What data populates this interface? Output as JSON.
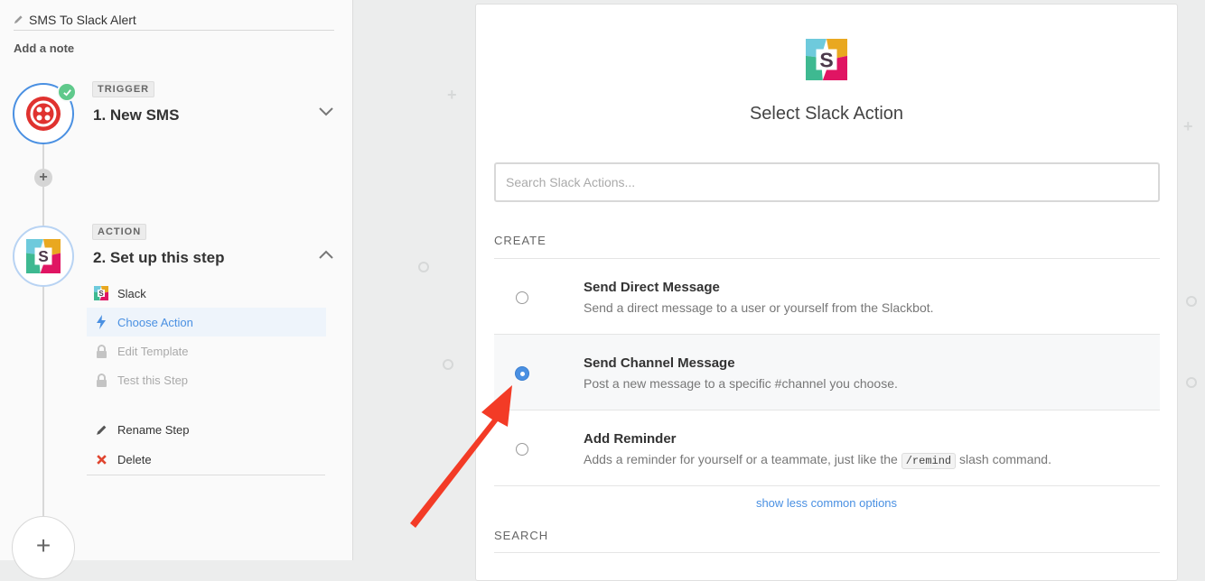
{
  "zap": {
    "title": "SMS To Slack Alert",
    "add_note": "Add a note"
  },
  "steps": [
    {
      "tag": "TRIGGER",
      "name": "1. New SMS",
      "app_icon": "twilio-icon",
      "status": "complete"
    },
    {
      "tag": "ACTION",
      "name": "2. Set up this step",
      "app_icon": "slack-icon",
      "status": "in-progress"
    }
  ],
  "substeps": [
    {
      "label": "Slack",
      "icon": "slack-icon",
      "state": "done"
    },
    {
      "label": "Choose Action",
      "icon": "lightning-icon",
      "state": "active"
    },
    {
      "label": "Edit Template",
      "icon": "lock-icon",
      "state": "locked"
    },
    {
      "label": "Test this Step",
      "icon": "lock-icon",
      "state": "locked"
    }
  ],
  "step_actions": {
    "rename": "Rename Step",
    "delete": "Delete"
  },
  "panel": {
    "title": "Select Slack Action",
    "search_placeholder": "Search Slack Actions...",
    "create_label": "CREATE",
    "search_label": "SEARCH",
    "show_less": "show less common options"
  },
  "options": [
    {
      "title": "Send Direct Message",
      "desc": "Send a direct message to a user or yourself from the Slackbot.",
      "selected": false
    },
    {
      "title": "Send Channel Message",
      "desc": "Post a new message to a specific #channel you choose.",
      "selected": true
    },
    {
      "title": "Add Reminder",
      "desc_before": "Adds a reminder for yourself or a teammate, just like the",
      "desc_code": "/remind",
      "desc_after": "slash command.",
      "selected": false
    }
  ],
  "colors": {
    "accent": "#4a90e2",
    "success": "#5fc98b",
    "twilio": "#e0322f",
    "arrow": "#f33b26",
    "delete": "#e0452f"
  }
}
